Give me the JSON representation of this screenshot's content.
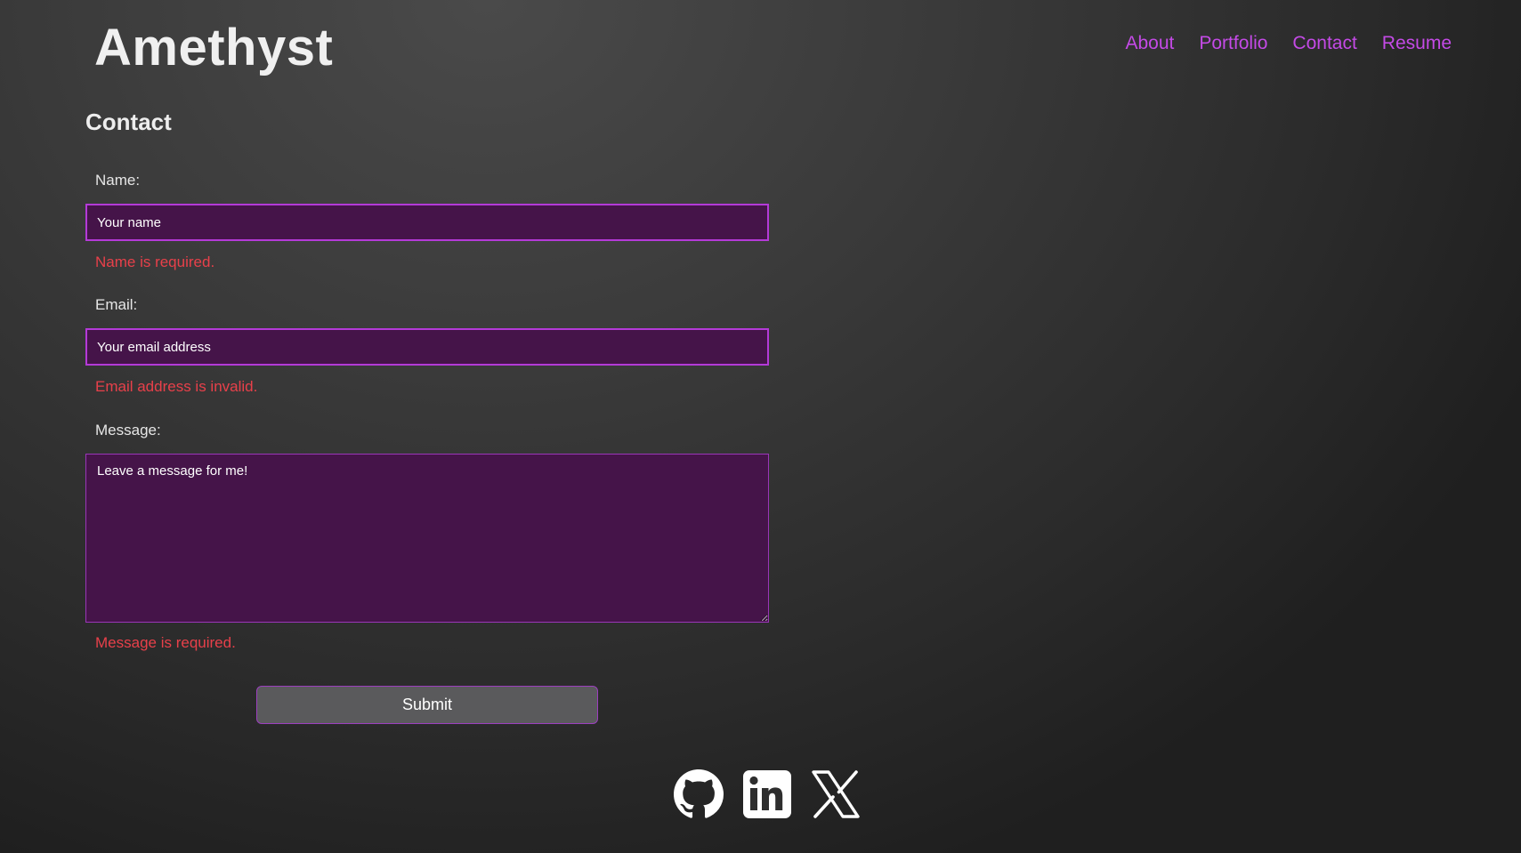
{
  "header": {
    "brand": "Amethyst",
    "nav": [
      {
        "label": "About"
      },
      {
        "label": "Portfolio"
      },
      {
        "label": "Contact"
      },
      {
        "label": "Resume"
      }
    ]
  },
  "page": {
    "title": "Contact"
  },
  "form": {
    "name": {
      "label": "Name:",
      "placeholder": "Your name",
      "value": "",
      "error": "Name is required."
    },
    "email": {
      "label": "Email:",
      "placeholder": "Your email address",
      "value": "",
      "error": "Email address is invalid."
    },
    "message": {
      "label": "Message:",
      "placeholder": "Leave a message for me!",
      "value": "",
      "error": "Message is required."
    },
    "submit_label": "Submit"
  },
  "socials": [
    {
      "icon": "github-icon"
    },
    {
      "icon": "linkedin-icon"
    },
    {
      "icon": "x-icon"
    }
  ],
  "colors": {
    "accent": "#c44ae6",
    "input_bg": "#451449",
    "error": "#e8404a",
    "button_bg": "#5a5a5c"
  }
}
